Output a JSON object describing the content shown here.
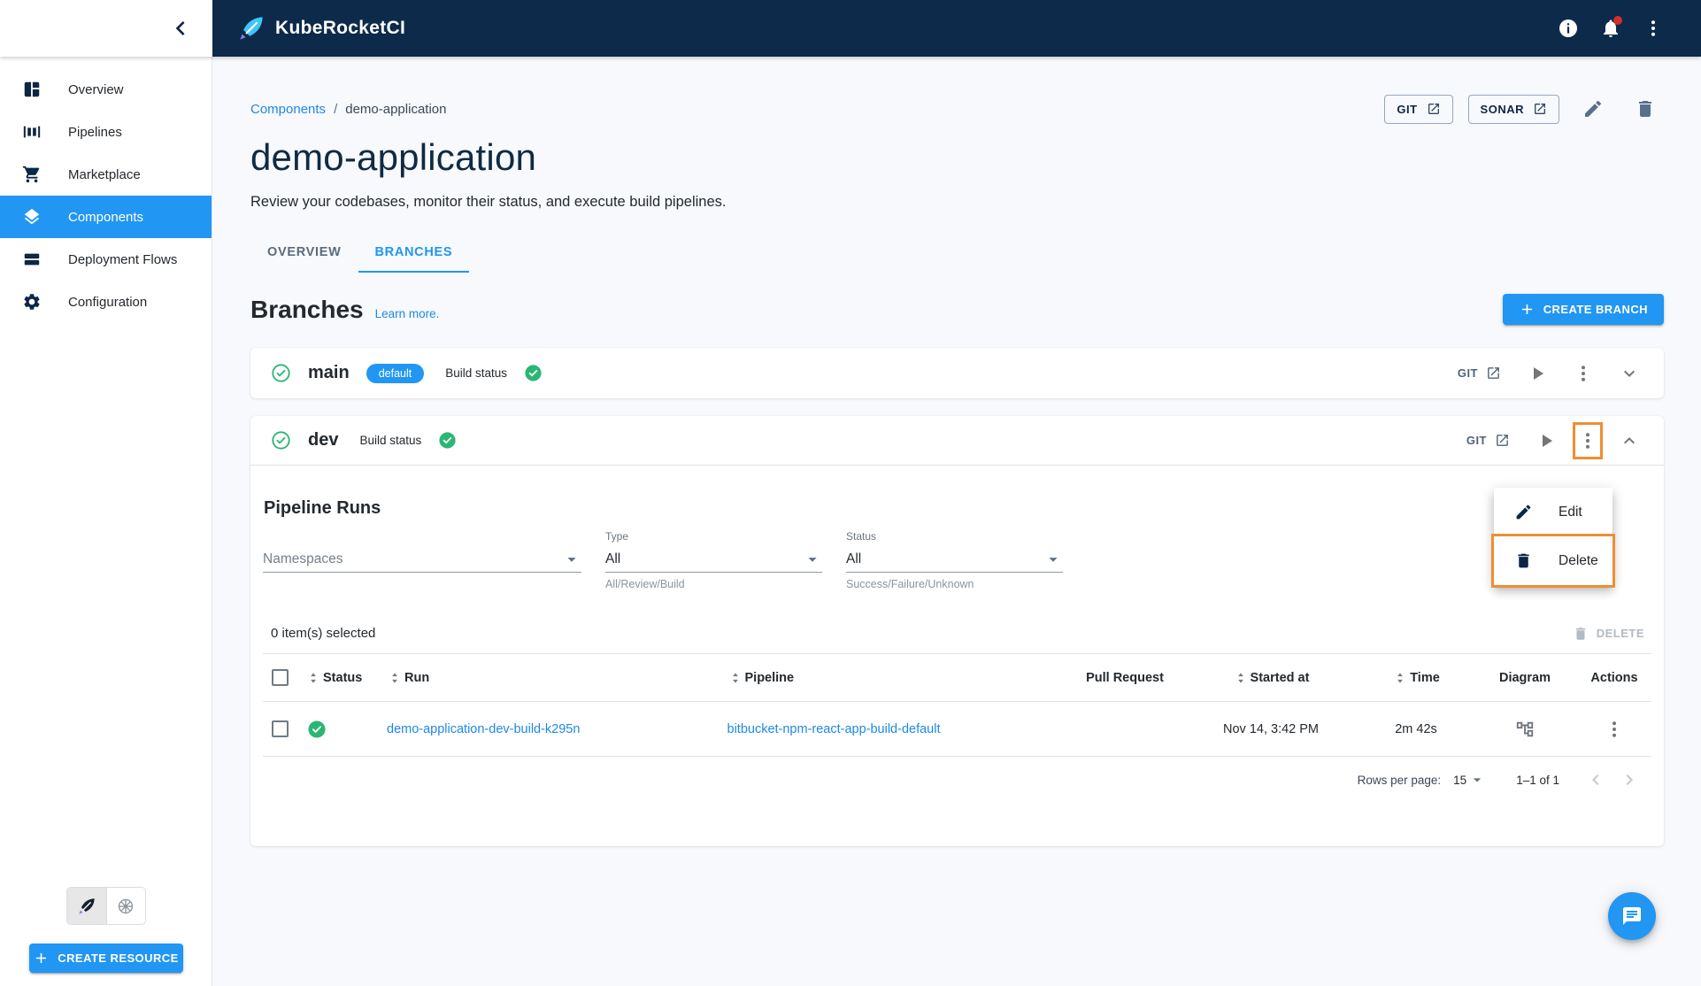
{
  "topbar": {
    "brand": "KubeRocketCI"
  },
  "sidebar": {
    "items": [
      {
        "label": "Overview"
      },
      {
        "label": "Pipelines"
      },
      {
        "label": "Marketplace"
      },
      {
        "label": "Components"
      },
      {
        "label": "Deployment Flows"
      },
      {
        "label": "Configuration"
      }
    ],
    "create_resource_label": "CREATE RESOURCE"
  },
  "page": {
    "breadcrumb": {
      "root": "Components",
      "separator": "/",
      "current": "demo-application"
    },
    "title": "demo-application",
    "subtitle": "Review your codebases, monitor their status, and execute build pipelines.",
    "actions": {
      "git_label": "GIT",
      "sonar_label": "SONAR"
    }
  },
  "tabs": {
    "overview": "OVERVIEW",
    "branches": "BRANCHES"
  },
  "branches_section": {
    "heading": "Branches",
    "learn_more": "Learn more.",
    "create_branch_label": "CREATE BRANCH"
  },
  "branches": [
    {
      "name": "main",
      "chip": "default",
      "build_status_label": "Build status",
      "git_label": "GIT"
    },
    {
      "name": "dev",
      "build_status_label": "Build status",
      "git_label": "GIT"
    }
  ],
  "context_menu": {
    "edit": "Edit",
    "delete": "Delete"
  },
  "pipeline_runs": {
    "heading": "Pipeline Runs",
    "filters": {
      "namespaces_placeholder": "Namespaces",
      "type_label": "Type",
      "type_value": "All",
      "type_helper": "All/Review/Build",
      "status_label": "Status",
      "status_value": "All",
      "status_helper": "Success/Failure/Unknown"
    },
    "selection_text": "0 item(s) selected",
    "delete_label": "DELETE",
    "table": {
      "columns": [
        "Status",
        "Run",
        "Pipeline",
        "Pull Request",
        "Started at",
        "Time",
        "Diagram",
        "Actions"
      ],
      "rows": [
        {
          "status": "success",
          "run": "demo-application-dev-build-k295n",
          "pipeline": "bitbucket-npm-react-app-build-default",
          "pull_request": "",
          "started_at": "Nov 14, 3:42 PM",
          "time": "2m 42s"
        }
      ]
    },
    "pagination": {
      "rows_per_page_label": "Rows per page:",
      "rows_per_page_value": "15",
      "range": "1–1 of 1"
    }
  },
  "colors": {
    "accent": "#2196f3",
    "topbar": "#0d2a4a",
    "navy_icon": "#0c2646",
    "success": "#2bb673",
    "link": "#1e88e5",
    "highlight": "#ee8e33"
  }
}
